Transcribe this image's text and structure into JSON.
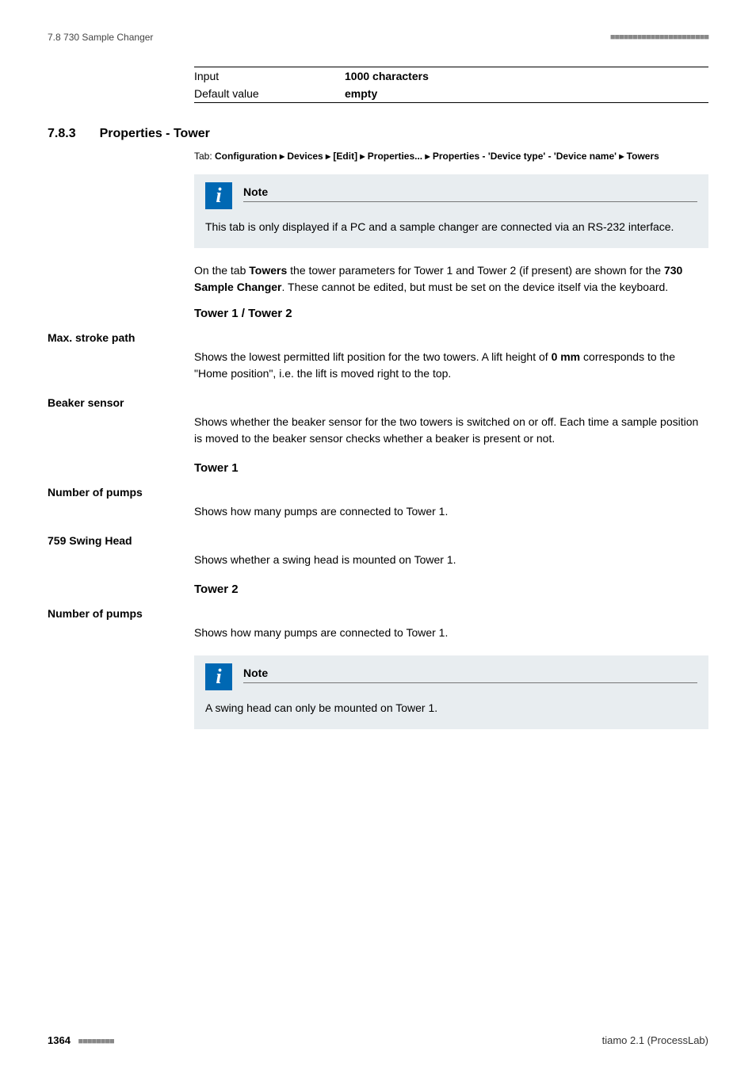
{
  "header": {
    "left": "7.8 730 Sample Changer",
    "dashes": "■■■■■■■■■■■■■■■■■■■■■■"
  },
  "def_table": {
    "rows": [
      {
        "label": "Input",
        "value": "1000 characters"
      },
      {
        "label": "Default value",
        "value": "empty"
      }
    ]
  },
  "section": {
    "num": "7.8.3",
    "title": "Properties - Tower"
  },
  "tab_line_prefix": "Tab: ",
  "tab_line_bold": "Configuration ▸ Devices ▸ [Edit] ▸ Properties... ▸ Properties - 'Device type' - 'Device name' ▸ Towers",
  "note1": {
    "label": "Note",
    "body": "This tab is only displayed if a PC and a sample changer are connected via an RS-232 interface."
  },
  "para1_parts": {
    "p1": "On the tab ",
    "b1": "Towers",
    "p2": " the tower parameters for Tower 1 and Tower 2 (if present) are shown for the ",
    "b2": "730 Sample Changer",
    "p3": ". These cannot be edited, but must be set on the device itself via the keyboard."
  },
  "subhead1": "Tower 1 / Tower 2",
  "field1": {
    "label": "Max. stroke path",
    "body_p1": "Shows the lowest permitted lift position for the two towers. A lift height of ",
    "body_b1": "0 mm",
    "body_p2": " corresponds to the \"Home position\", i.e. the lift is moved right to the top."
  },
  "field2": {
    "label": "Beaker sensor",
    "body": "Shows whether the beaker sensor for the two towers is switched on or off. Each time a sample position is moved to the beaker sensor checks whether a beaker is present or not."
  },
  "subhead2": "Tower 1",
  "field3": {
    "label": "Number of pumps",
    "body": "Shows how many pumps are connected to Tower 1."
  },
  "field4": {
    "label": "759 Swing Head",
    "body": "Shows whether a swing head is mounted on Tower 1."
  },
  "subhead3": "Tower 2",
  "field5": {
    "label": "Number of pumps",
    "body": "Shows how many pumps are connected to Tower 1."
  },
  "note2": {
    "label": "Note",
    "body": "A swing head can only be mounted on Tower 1."
  },
  "footer": {
    "page": "1364",
    "dashes": "■■■■■■■■",
    "right": "tiamo 2.1 (ProcessLab)"
  }
}
